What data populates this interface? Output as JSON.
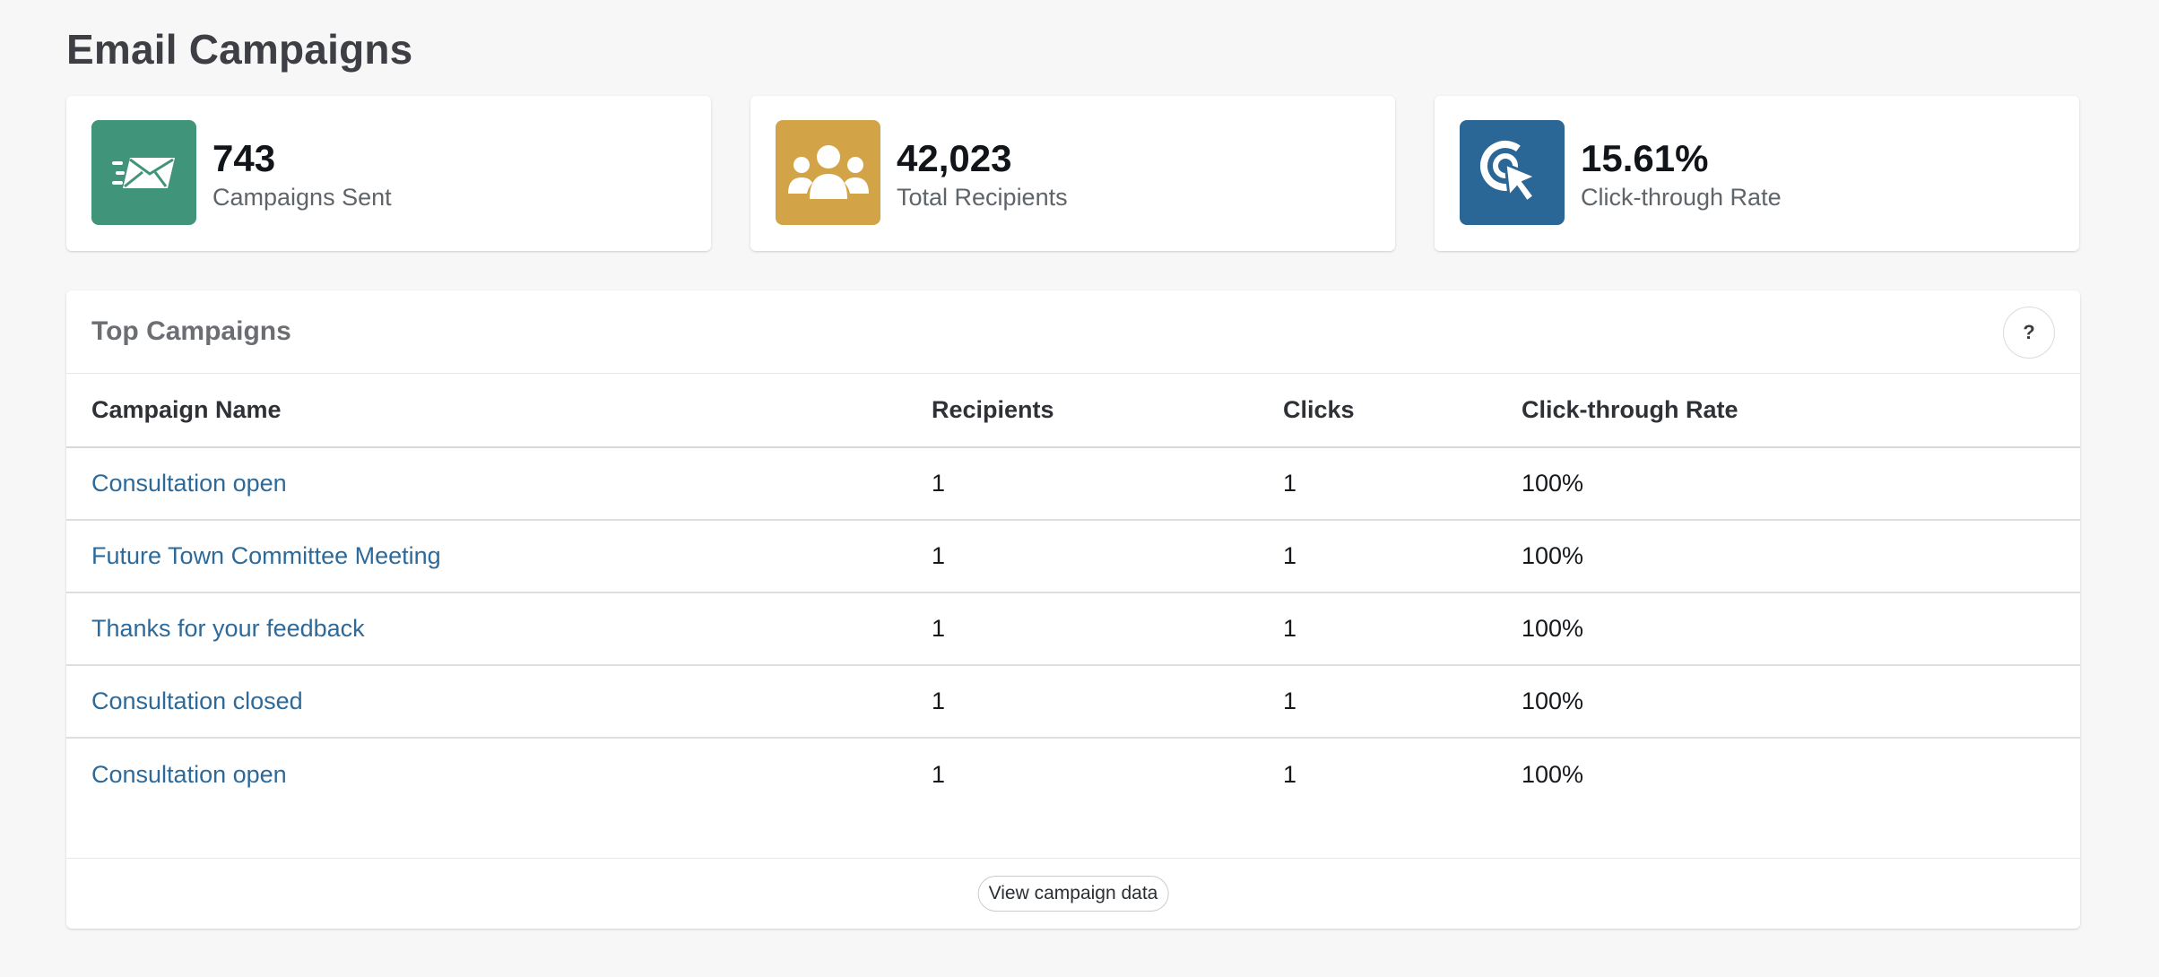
{
  "page": {
    "title": "Email Campaigns"
  },
  "stats": [
    {
      "value": "743",
      "label": "Campaigns Sent",
      "icon": "envelope-sent-icon",
      "color": "#3f9479"
    },
    {
      "value": "42,023",
      "label": "Total Recipients",
      "icon": "users-group-icon",
      "color": "#d3a347"
    },
    {
      "value": "15.61%",
      "label": "Click-through Rate",
      "icon": "cursor-click-icon",
      "color": "#2b6796"
    }
  ],
  "top_campaigns": {
    "title": "Top Campaigns",
    "help_label": "?",
    "columns": [
      "Campaign Name",
      "Recipients",
      "Clicks",
      "Click-through Rate"
    ],
    "rows": [
      {
        "name": "Consultation open",
        "recipients": "1",
        "clicks": "1",
        "ctr": "100%"
      },
      {
        "name": "Future Town Committee Meeting",
        "recipients": "1",
        "clicks": "1",
        "ctr": "100%"
      },
      {
        "name": "Thanks for your feedback",
        "recipients": "1",
        "clicks": "1",
        "ctr": "100%"
      },
      {
        "name": "Consultation closed",
        "recipients": "1",
        "clicks": "1",
        "ctr": "100%"
      },
      {
        "name": "Consultation open",
        "recipients": "1",
        "clicks": "1",
        "ctr": "100%"
      }
    ],
    "footer_button": "View campaign data"
  },
  "colors": {
    "link": "#2d6a9a",
    "background": "#f7f7f7"
  }
}
